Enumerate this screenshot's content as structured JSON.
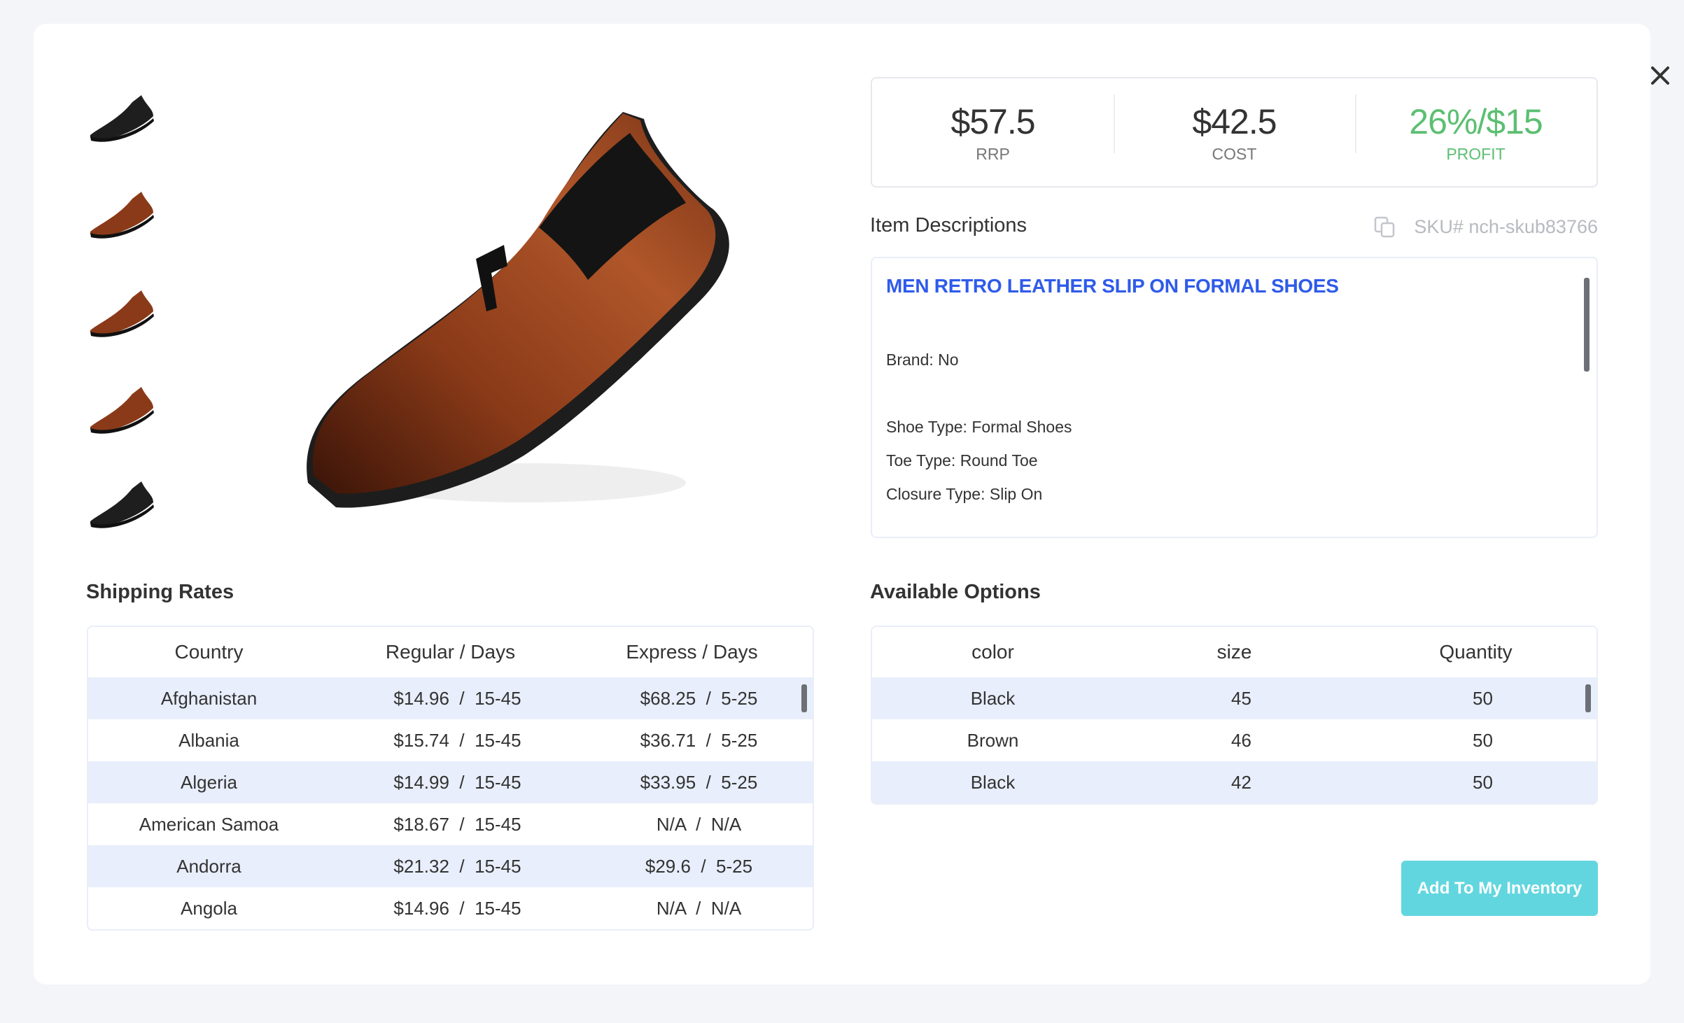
{
  "prices": [
    {
      "value": "$57.5",
      "label": "RRP"
    },
    {
      "value": "$42.5",
      "label": "COST"
    },
    {
      "value": "26%/$15",
      "label": "PROFIT"
    }
  ],
  "colors": {
    "profit": "#5cbf72",
    "title": "#2f5bea",
    "button": "#62d6df",
    "row_alt": "#e8eefb"
  },
  "description": {
    "heading": "Item Descriptions",
    "sku": "SKU# nch-skub83766",
    "title": "MEN RETRO LEATHER SLIP ON FORMAL SHOES",
    "lines": [
      "Brand: No",
      "Shoe Type: Formal Shoes",
      "Toe Type: Round Toe",
      "Closure Type: Slip On"
    ]
  },
  "thumbnails": [
    "black-shoe-side",
    "brown-shoe-angle",
    "brown-shoe-profile",
    "brown-shoe-rear",
    "black-shoe-pair"
  ],
  "shipping": {
    "heading": "Shipping Rates",
    "columns": [
      "Country",
      "Regular / Days",
      "Express / Days"
    ],
    "rows": [
      [
        "Afghanistan",
        "$14.96  /  15-45",
        "$68.25  /  5-25"
      ],
      [
        "Albania",
        "$15.74  /  15-45",
        "$36.71  /  5-25"
      ],
      [
        "Algeria",
        "$14.99  /  15-45",
        "$33.95  /  5-25"
      ],
      [
        "American Samoa",
        "$18.67  /  15-45",
        "N/A  /  N/A"
      ],
      [
        "Andorra",
        "$21.32  /  15-45",
        "$29.6  /  5-25"
      ],
      [
        "Angola",
        "$14.96  /  15-45",
        "N/A  /  N/A"
      ]
    ]
  },
  "options": {
    "heading": "Available Options",
    "columns": [
      "color",
      "size",
      "Quantity"
    ],
    "rows": [
      [
        "Black",
        "45",
        "50"
      ],
      [
        "Brown",
        "46",
        "50"
      ],
      [
        "Black",
        "42",
        "50"
      ]
    ]
  },
  "button": {
    "label": "Add To My Inventory"
  }
}
